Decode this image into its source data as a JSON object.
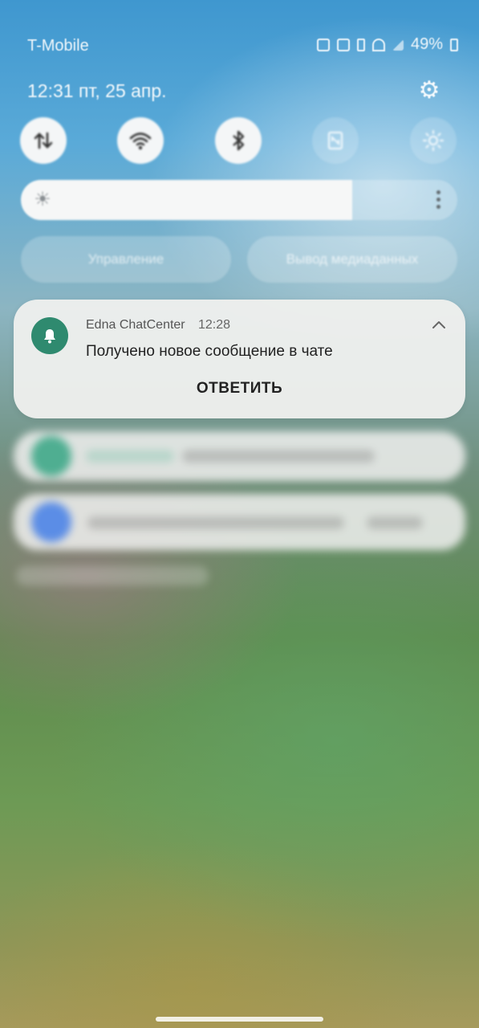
{
  "status_bar": {
    "carrier": "T-Mobile",
    "battery": "49%",
    "icons": [
      "nfc-icon",
      "cast-icon",
      "vibrate-icon",
      "wifi-calling-icon",
      "signal-icon",
      "battery-icon"
    ]
  },
  "header": {
    "datetime": "12:31  пт, 25 апр.",
    "settings_icon": "gear-icon"
  },
  "quick_settings": {
    "toggles": [
      {
        "name": "mobile-data",
        "icon": "data-arrows-icon",
        "state": "on"
      },
      {
        "name": "wifi",
        "icon": "wifi-icon",
        "state": "on"
      },
      {
        "name": "bluetooth",
        "icon": "bluetooth-icon",
        "state": "on"
      },
      {
        "name": "nfc",
        "icon": "nfc-icon",
        "state": "off"
      },
      {
        "name": "eye-comfort",
        "icon": "sun-icon",
        "state": "off"
      }
    ],
    "brightness_level": 0.76,
    "buttons": {
      "device_control": "Управление",
      "media_output": "Вывод медиаданных"
    }
  },
  "notification": {
    "app_name": "Edna ChatCenter",
    "time": "12:28",
    "message": "Получено новое сообщение в чате",
    "action": "ОТВЕТИТЬ",
    "accent_color": "#2f8a6f"
  },
  "colors": {
    "card_background": "#eeefed",
    "toggle_on": "#f4f6f7"
  }
}
